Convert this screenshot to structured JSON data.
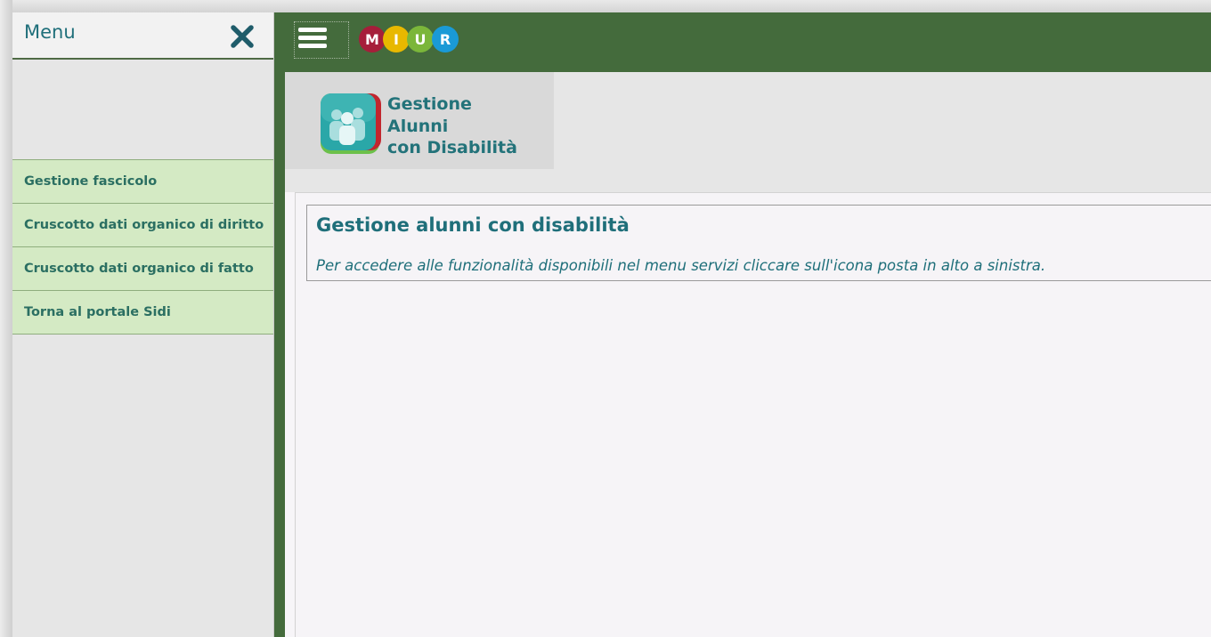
{
  "sidebar": {
    "title": "Menu",
    "close_icon": "close-icon",
    "items": [
      {
        "label": "Gestione fascicolo"
      },
      {
        "label": "Cruscotto dati organico di diritto"
      },
      {
        "label": "Cruscotto dati organico di fatto"
      },
      {
        "label": "Torna al portale Sidi"
      }
    ]
  },
  "topbar": {
    "menu_icon": "hamburger-menu-icon",
    "logo": {
      "text": "MIUR",
      "letters": [
        "M",
        "I",
        "U",
        "R"
      ],
      "colors": [
        "#a61e3a",
        "#e8b800",
        "#7bb63a",
        "#1a9ad6"
      ]
    }
  },
  "app": {
    "name_lines": [
      "Gestione",
      "Alunni",
      "con Disabilità"
    ]
  },
  "panel": {
    "title": "Gestione alunni con disabilità",
    "text": "Per accedere alle funzionalità disponibili nel menu servizi cliccare sull'icona posta in alto a sinistra."
  },
  "colors": {
    "topbar_green": "#446b3c",
    "menu_item_bg": "#d4eac4",
    "accent_teal": "#1f6f7a"
  }
}
